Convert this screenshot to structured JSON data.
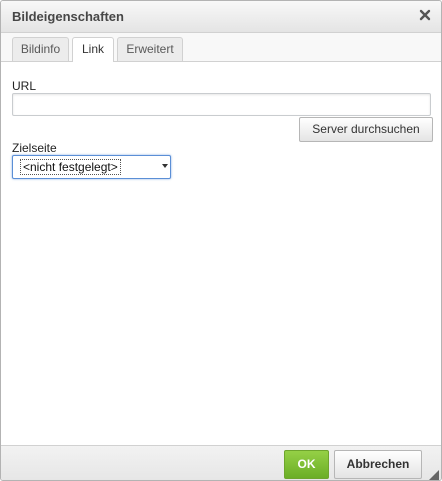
{
  "dialog": {
    "title": "Bildeigenschaften",
    "close_icon": "close-icon"
  },
  "tabs": [
    {
      "label": "Bildinfo",
      "active": false
    },
    {
      "label": "Link",
      "active": true
    },
    {
      "label": "Erweitert",
      "active": false
    }
  ],
  "link_tab": {
    "url_label": "URL",
    "url_value": "",
    "browse_button": "Server durchsuchen",
    "target_label": "Zielseite",
    "target_selected": "<nicht festgelegt>"
  },
  "footer": {
    "ok_label": "OK",
    "cancel_label": "Abbrechen"
  },
  "colors": {
    "ok_button": "#7cbd32",
    "focus_border": "#5b8fd6"
  }
}
